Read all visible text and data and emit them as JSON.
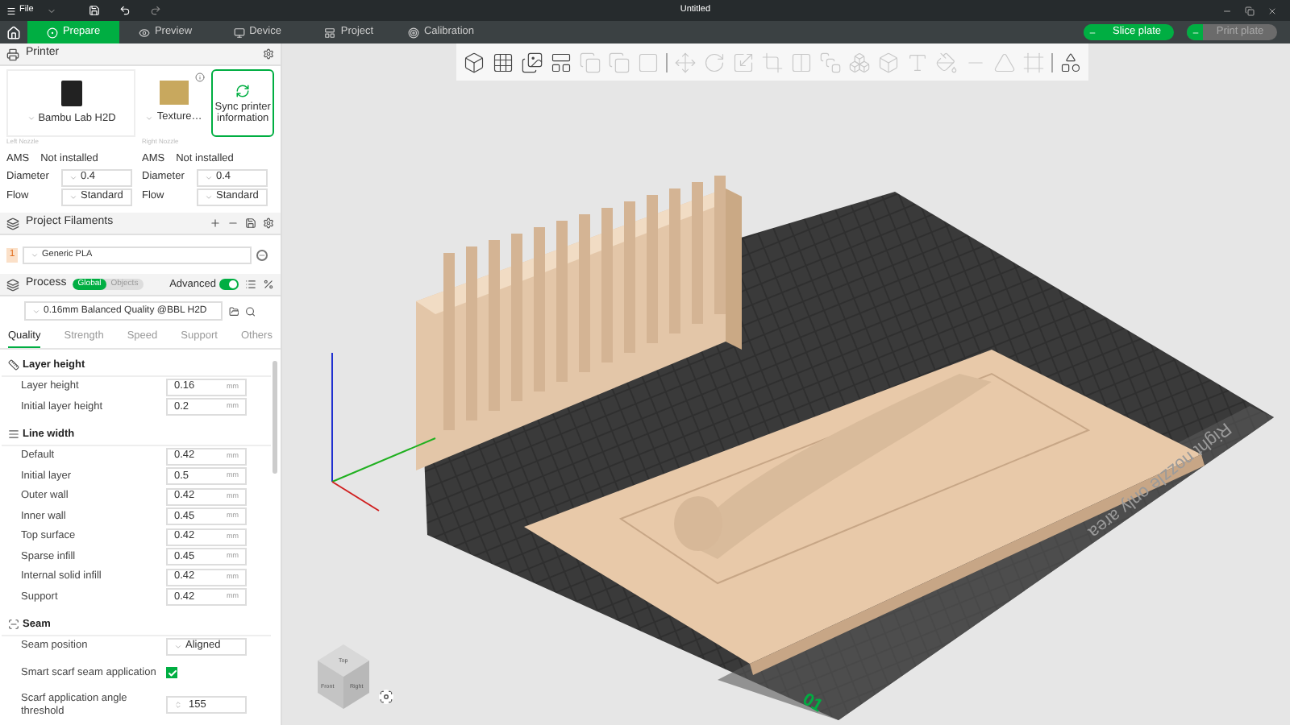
{
  "title_bar": {
    "menu": "File",
    "title": "Untitled"
  },
  "tabs": [
    {
      "label": "Prepare",
      "selected": true
    },
    {
      "label": "Preview",
      "selected": false
    },
    {
      "label": "Device",
      "selected": false
    },
    {
      "label": "Project",
      "selected": false
    },
    {
      "label": "Calibration",
      "selected": false
    }
  ],
  "actions": [
    {
      "label": "Slice plate",
      "disabled": false
    },
    {
      "label": "Print plate",
      "disabled": true
    }
  ],
  "printer": {
    "title": "Printer",
    "model": "Bambu Lab H2D",
    "plate": "Texture…",
    "sync": "Sync printer information",
    "nozzles": [
      {
        "label": "Left Nozzle",
        "ams": "AMS",
        "ams_value": "Not installed",
        "diameter_label": "Diameter",
        "diameter": "0.4",
        "flow_label": "Flow",
        "flow": "Standard"
      },
      {
        "label": "Right Nozzle",
        "ams": "AMS",
        "ams_value": "Not installed",
        "diameter_label": "Diameter",
        "diameter": "0.4",
        "flow_label": "Flow",
        "flow": "Standard"
      }
    ]
  },
  "filaments": {
    "title": "Project Filaments",
    "items": [
      {
        "index": "1",
        "name": "Generic PLA",
        "color": "#fbe0c8"
      }
    ]
  },
  "process": {
    "title": "Process",
    "scope": [
      {
        "label": "Global",
        "selected": true
      },
      {
        "label": "Objects",
        "selected": false
      }
    ],
    "advanced": {
      "label": "Advanced",
      "on": true
    },
    "preset": "0.16mm Balanced Quality @BBL H2D",
    "tabs": [
      {
        "label": "Quality",
        "selected": true
      },
      {
        "label": "Strength",
        "selected": false
      },
      {
        "label": "Speed",
        "selected": false
      },
      {
        "label": "Support",
        "selected": false
      },
      {
        "label": "Others",
        "selected": false
      }
    ],
    "sections": [
      {
        "title": "Layer height",
        "rows": [
          {
            "kind": "input",
            "label": "Layer height",
            "value": "0.16",
            "unit": "mm"
          },
          {
            "kind": "input",
            "label": "Initial layer height",
            "value": "0.2",
            "unit": "mm"
          }
        ]
      },
      {
        "title": "Line width",
        "rows": [
          {
            "kind": "input",
            "label": "Default",
            "value": "0.42",
            "unit": "mm"
          },
          {
            "kind": "input",
            "label": "Initial layer",
            "value": "0.5",
            "unit": "mm"
          },
          {
            "kind": "input",
            "label": "Outer wall",
            "value": "0.42",
            "unit": "mm"
          },
          {
            "kind": "input",
            "label": "Inner wall",
            "value": "0.45",
            "unit": "mm"
          },
          {
            "kind": "input",
            "label": "Top surface",
            "value": "0.42",
            "unit": "mm"
          },
          {
            "kind": "input",
            "label": "Sparse infill",
            "value": "0.45",
            "unit": "mm"
          },
          {
            "kind": "input",
            "label": "Internal solid infill",
            "value": "0.42",
            "unit": "mm"
          },
          {
            "kind": "input",
            "label": "Support",
            "value": "0.42",
            "unit": "mm"
          }
        ]
      },
      {
        "title": "Seam",
        "rows": [
          {
            "kind": "dropdown",
            "label": "Seam position",
            "value": "Aligned"
          },
          {
            "kind": "checkbox",
            "label": "Smart scarf seam application",
            "checked": true
          },
          {
            "kind": "spin",
            "label": "Scarf application angle threshold",
            "value": "155"
          }
        ]
      }
    ]
  },
  "toolbar": [
    {
      "kind": "tool",
      "disabled": false
    },
    {
      "kind": "tool",
      "disabled": false
    },
    {
      "kind": "tool",
      "disabled": false
    },
    {
      "kind": "tool",
      "disabled": false
    },
    {
      "kind": "tool",
      "disabled": true
    },
    {
      "kind": "tool",
      "disabled": true
    },
    {
      "kind": "tool",
      "disabled": true
    },
    {
      "kind": "separator"
    },
    {
      "kind": "tool",
      "disabled": true
    },
    {
      "kind": "tool",
      "disabled": true
    },
    {
      "kind": "tool",
      "disabled": true
    },
    {
      "kind": "tool",
      "disabled": true
    },
    {
      "kind": "tool",
      "disabled": true
    },
    {
      "kind": "tool",
      "disabled": true
    },
    {
      "kind": "tool",
      "disabled": true
    },
    {
      "kind": "tool",
      "disabled": true
    },
    {
      "kind": "tool",
      "disabled": true
    },
    {
      "kind": "tool",
      "disabled": true
    },
    {
      "kind": "tool",
      "disabled": true
    },
    {
      "kind": "tool",
      "disabled": true
    },
    {
      "kind": "tool",
      "disabled": true
    },
    {
      "kind": "separator"
    },
    {
      "kind": "tool",
      "disabled": false
    }
  ],
  "viewport": {
    "plate_label": "Right nozzle only area",
    "plate_number": "01",
    "cube": [
      "Top",
      "Front",
      "Right"
    ]
  }
}
